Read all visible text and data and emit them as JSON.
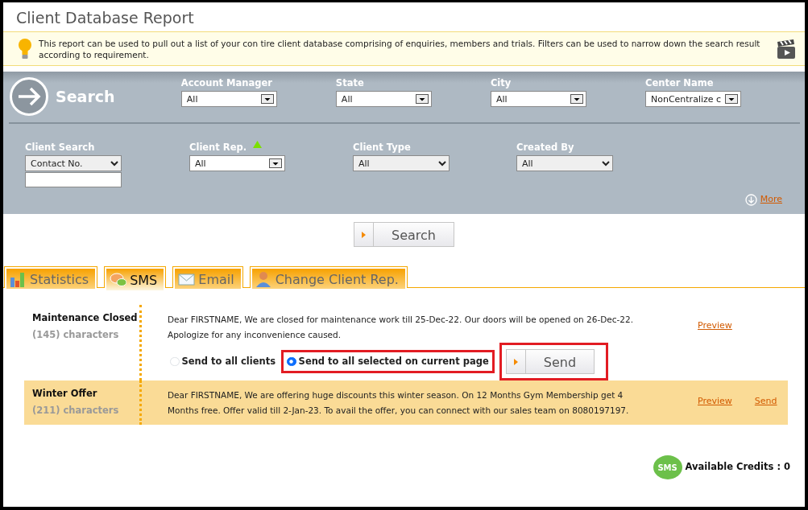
{
  "title": "Client Database Report",
  "info": {
    "text": "This report can be used to pull out a list of your con tire client database comprising of enquiries, members and trials. Filters can be used to narrow down the search result according to requirement."
  },
  "search_panel": {
    "title": "Search",
    "row_1": [
      {
        "label": "Account Manager",
        "kind": "combo",
        "value": "All"
      },
      {
        "label": "State",
        "kind": "combo",
        "value": "All"
      },
      {
        "label": "City",
        "kind": "combo",
        "value": "All"
      },
      {
        "label": "Center Name",
        "kind": "combo",
        "value": "NonCentralize c"
      }
    ],
    "row_2": [
      {
        "label": "Client Search",
        "kind": "select_input",
        "value": "Contact No."
      },
      {
        "label": "Client Rep.",
        "kind": "combo_sorted",
        "value": "All"
      },
      {
        "label": "Client Type",
        "kind": "select",
        "value": "All"
      },
      {
        "label": "Created By",
        "kind": "select",
        "value": "All"
      }
    ],
    "more_link": "More"
  },
  "search_button": "Search",
  "tabs": [
    {
      "label": "Statistics",
      "selected": false
    },
    {
      "label": "SMS",
      "selected": true
    },
    {
      "label": "Email",
      "selected": false
    },
    {
      "label": "Change Client Rep.",
      "selected": false
    }
  ],
  "messages": [
    {
      "title": "Maintenance Closed",
      "count": "(145) characters",
      "text": "Dear FIRSTNAME, We are closed for maintenance work till 25-Dec-22. Our doors will be opened on 26-Dec-22. Apologize for any inconvenience caused.",
      "highlighted": false,
      "links": [
        "Preview"
      ],
      "send_options": [
        {
          "label": "Send to all clients",
          "selected": false,
          "outlined": false
        },
        {
          "label": "Send to all selected on current page",
          "selected": true,
          "outlined": true
        }
      ],
      "send_button": {
        "label": "Send",
        "outlined": true
      }
    },
    {
      "title": "Winter Offer",
      "count": "(211) characters",
      "text": "Dear FIRSTNAME, We are offering huge discounts this winter season. On 12 Months Gym Membership get 4 Months free. Offer valid till 2-Jan-23. To avail the offer, you can connect with our sales team on 8080197197.",
      "highlighted": true,
      "links": [
        "Preview",
        "Send"
      ]
    }
  ],
  "credits": {
    "badge": "SMS",
    "text": "Available Credits : 0"
  }
}
